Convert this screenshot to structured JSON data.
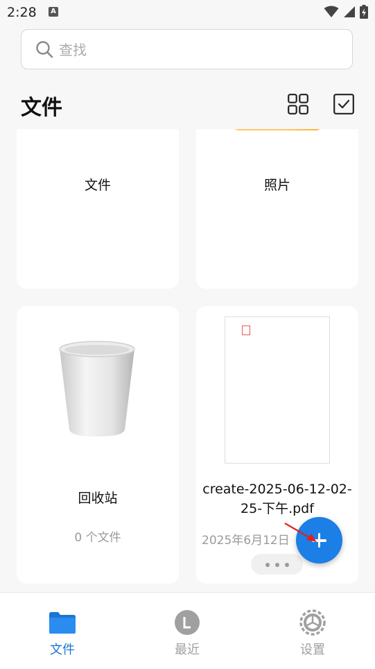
{
  "status_bar": {
    "time": "2:28",
    "a_badge": "A"
  },
  "search": {
    "placeholder": "查找"
  },
  "header": {
    "title": "文件"
  },
  "cards": [
    {
      "label": "文件",
      "subtitle": ""
    },
    {
      "label": "照片",
      "subtitle": ""
    },
    {
      "label": "回收站",
      "subtitle": "0 个文件"
    },
    {
      "label": "create-2025-06-12-02-25-下午.pdf",
      "subtitle": "2025年6月12日"
    }
  ],
  "colors": {
    "accent": "#1b7fe6",
    "nav_active": "#1976d2",
    "nav_inactive": "#a0a0a0"
  },
  "bottom_nav": [
    {
      "label": "文件",
      "icon": "folder-icon",
      "active": true
    },
    {
      "label": "最近",
      "icon": "clock-icon",
      "active": false
    },
    {
      "label": "设置",
      "icon": "settings-icon",
      "active": false
    }
  ]
}
